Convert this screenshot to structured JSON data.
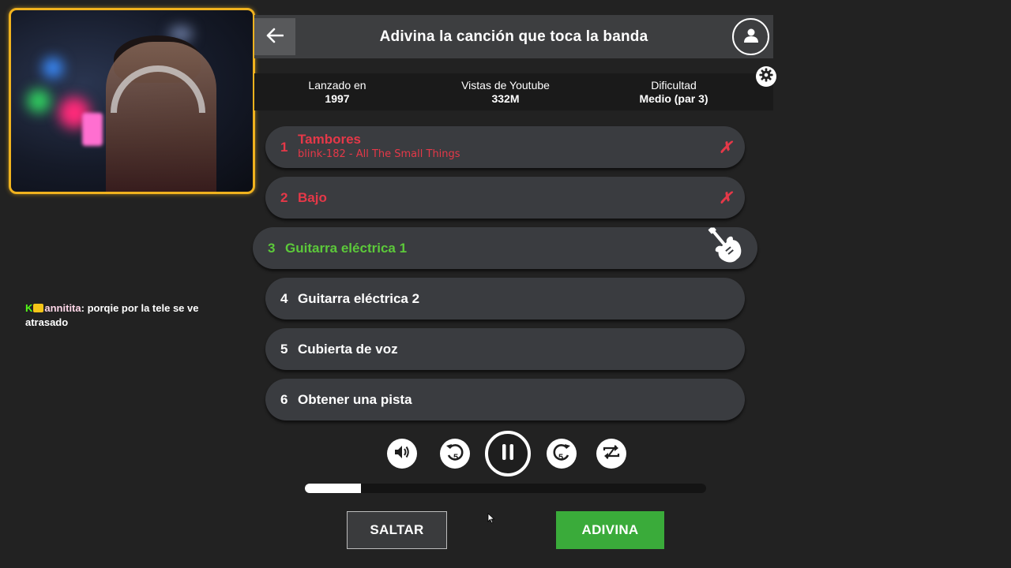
{
  "webcam": {
    "label": "webcam-feed"
  },
  "chat": {
    "badge_letter": "K",
    "username": "annitita",
    "separator": ":",
    "message": "porqie por la tele se ve atrasado"
  },
  "header": {
    "title": "Adivina la canción que toca la banda",
    "back_icon": "arrow-left-icon",
    "profile_icon": "user-icon",
    "settings_icon": "gear-icon"
  },
  "info": {
    "released_label": "Lanzado en",
    "released_value": "1997",
    "views_label": "Vistas de Youtube",
    "views_value": "332M",
    "difficulty_label": "Dificultad",
    "difficulty_value": "Medio (par 3)"
  },
  "tracks": [
    {
      "num": "1",
      "name": "Tambores",
      "sub": "blink-182 - All The Small Things",
      "state": "failed",
      "mark": "✗"
    },
    {
      "num": "2",
      "name": "Bajo",
      "state": "failed",
      "mark": "✗"
    },
    {
      "num": "3",
      "name": "Guitarra eléctrica 1",
      "state": "active",
      "icon": "electric-guitar-icon"
    },
    {
      "num": "4",
      "name": "Guitarra eléctrica 2",
      "state": "locked"
    },
    {
      "num": "5",
      "name": "Cubierta de voz",
      "state": "locked"
    },
    {
      "num": "6",
      "name": "Obtener una pista",
      "state": "locked"
    }
  ],
  "controls": {
    "volume_icon": "volume-icon",
    "rewind_icon": "rewind-5-icon",
    "rewind_label": "5",
    "pause_icon": "pause-icon",
    "forward_icon": "forward-5-icon",
    "forward_label": "5",
    "loop_icon": "loop-icon"
  },
  "progress": {
    "fraction": 0.14
  },
  "buttons": {
    "skip": "SALTAR",
    "guess": "ADIVINA"
  },
  "colors": {
    "failed": "#e53848",
    "active": "#5cc93a",
    "guess_button": "#3aab3a",
    "webcam_border": "#f0b21e"
  }
}
